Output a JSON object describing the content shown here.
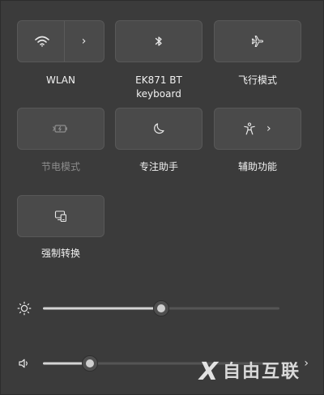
{
  "tiles": [
    {
      "name": "WLAN",
      "label": "WLAN",
      "icon": "wifi-icon",
      "active": true,
      "has_chevron": true
    },
    {
      "name": "bluetooth",
      "label": "EK871 BT keyboard",
      "label_line1": "EK871 BT",
      "label_line2": "keyboard",
      "icon": "bluetooth-icon",
      "active": true
    },
    {
      "name": "airplane",
      "label": "飞行模式",
      "icon": "airplane-icon",
      "active": true
    },
    {
      "name": "battery-saver",
      "label": "节电模式",
      "icon": "battery-saver-icon",
      "active": false
    },
    {
      "name": "focus-assist",
      "label": "专注助手",
      "icon": "moon-icon",
      "active": true
    },
    {
      "name": "accessibility",
      "label": "辅助功能",
      "icon": "accessibility-icon",
      "active": true,
      "has_chevron": true
    },
    {
      "name": "cast",
      "label": "强制转换",
      "icon": "cast-icon",
      "active": true
    }
  ],
  "sliders": {
    "brightness": {
      "icon": "brightness-icon",
      "value": 0.5
    },
    "volume": {
      "icon": "speaker-icon",
      "value": 0.2
    }
  },
  "watermark": {
    "mark": "X",
    "text": "自由互联"
  },
  "colors": {
    "panel_bg": "#3b3b3b",
    "tile_bg": "#4a4a4a",
    "text": "#f2f2f2",
    "dim_text": "#8c8c8c"
  }
}
